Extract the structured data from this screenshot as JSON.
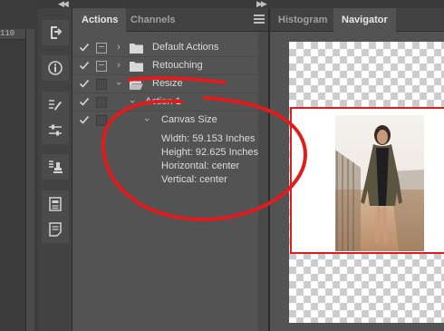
{
  "ruler": {
    "value": "110"
  },
  "actions_panel": {
    "tabs": [
      {
        "label": "Actions",
        "active": true
      },
      {
        "label": "Channels",
        "active": false
      }
    ],
    "rows": [
      {
        "label": "Default Actions",
        "checked": true,
        "dialog": true,
        "level": 0,
        "expanded": false,
        "type": "folder"
      },
      {
        "label": "Retouching",
        "checked": true,
        "dialog": true,
        "level": 0,
        "expanded": false,
        "type": "folder"
      },
      {
        "label": "Resize",
        "checked": true,
        "dialog": false,
        "level": 0,
        "expanded": true,
        "type": "folder"
      },
      {
        "label": "Action 1",
        "checked": true,
        "dialog": false,
        "level": 1,
        "expanded": true,
        "type": "action"
      },
      {
        "label": "Canvas Size",
        "checked": true,
        "dialog": false,
        "level": 2,
        "expanded": true,
        "type": "step"
      }
    ],
    "details": [
      "Width: 59.153 Inches",
      "Height: 92.625 Inches",
      "Horizontal: center",
      "Vertical: center"
    ]
  },
  "navigator_panel": {
    "tabs": [
      {
        "label": "Histogram",
        "active": false
      },
      {
        "label": "Navigator",
        "active": true
      }
    ]
  },
  "dock_icons": [
    "history-brush-icon",
    "info-icon",
    "brush-settings-icon",
    "adjustments-icon",
    "clone-source-icon",
    "properties-icon",
    "notes-icon"
  ],
  "colors": {
    "annotation": "#e01c1c",
    "panel_bg": "#535353",
    "tab_bg": "#424242"
  }
}
